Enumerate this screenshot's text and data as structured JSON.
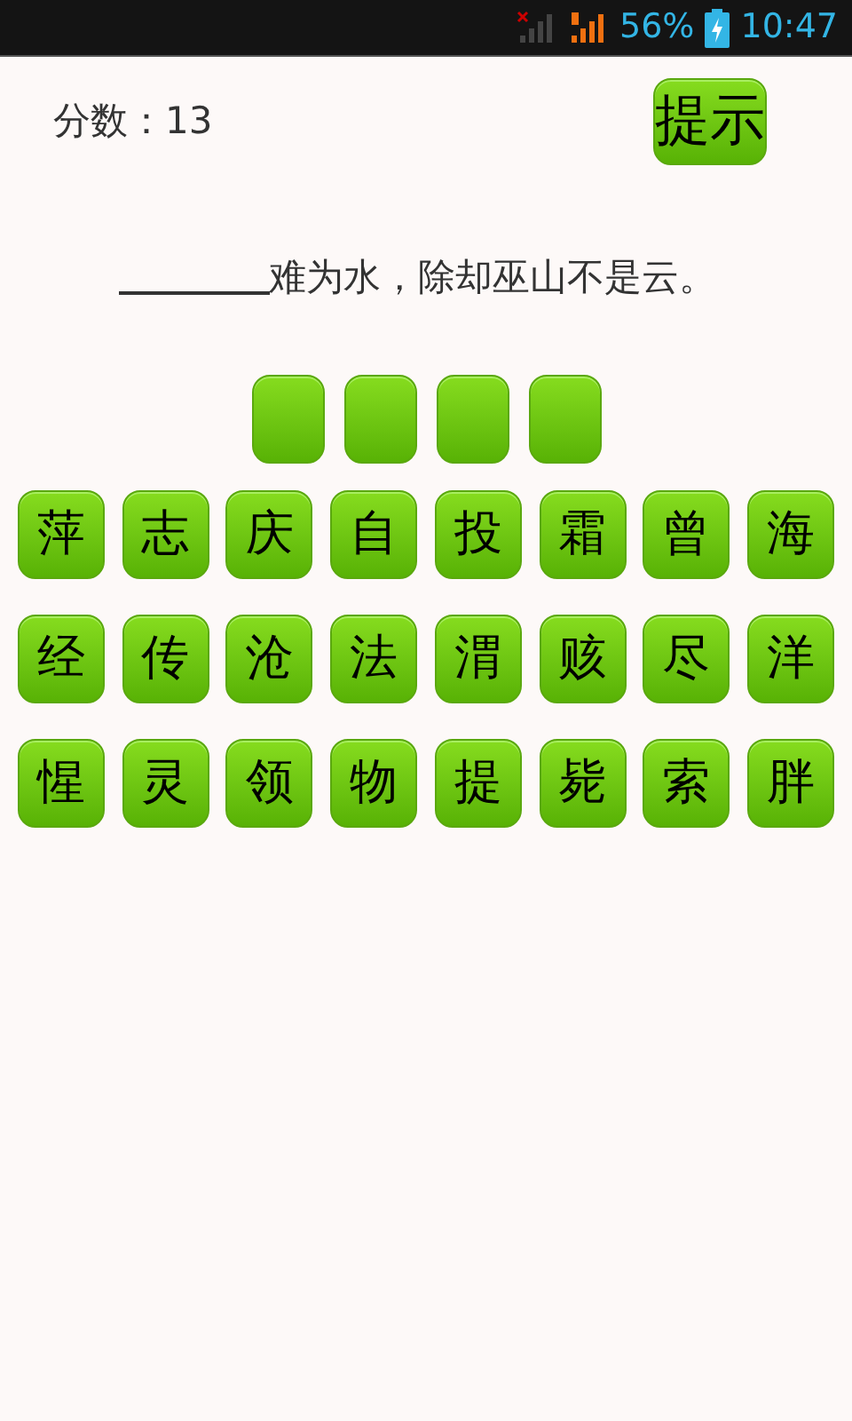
{
  "status_bar": {
    "battery": "56%",
    "time": "10:47"
  },
  "score": {
    "label": "分数：",
    "value": "13"
  },
  "hint_button": {
    "label": "提示"
  },
  "question": {
    "text": "难为水，除却巫山不是云。"
  },
  "answer_slots": [
    {
      "kind": "empty"
    },
    {
      "kind": "empty"
    },
    {
      "kind": "empty"
    },
    {
      "kind": "empty"
    }
  ],
  "letter_rows": [
    [
      "萍",
      "志",
      "庆",
      "自",
      "投",
      "霜",
      "曾",
      "海"
    ],
    [
      "经",
      "传",
      "沧",
      "法",
      "渭",
      "赅",
      "尽",
      "洋"
    ],
    [
      "惺",
      "灵",
      "领",
      "物",
      "提",
      "毙",
      "索",
      "胖"
    ]
  ]
}
